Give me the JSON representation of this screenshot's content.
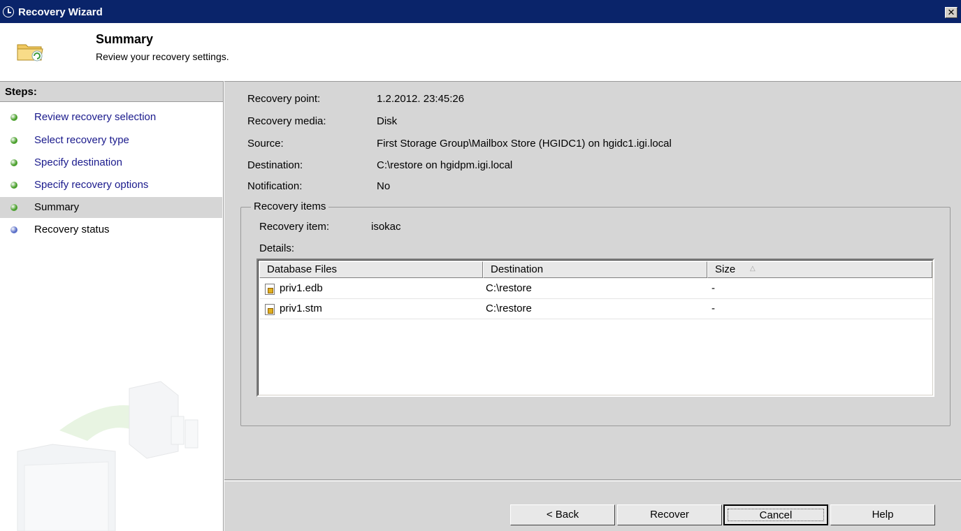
{
  "window": {
    "title": "Recovery Wizard",
    "close_glyph": "✕",
    "icon": "clock-icon"
  },
  "header": {
    "title": "Summary",
    "subtitle": "Review your recovery settings.",
    "icon": "folder-recovery-icon"
  },
  "steps": {
    "heading": "Steps:",
    "items": [
      {
        "label": "Review recovery selection",
        "state": "done"
      },
      {
        "label": "Select recovery type",
        "state": "done"
      },
      {
        "label": "Specify destination",
        "state": "done"
      },
      {
        "label": "Specify recovery options",
        "state": "done"
      },
      {
        "label": "Summary",
        "state": "current"
      },
      {
        "label": "Recovery status",
        "state": "future"
      }
    ],
    "colors": {
      "done": "#4aa02c",
      "current": "#4aa02c",
      "future": "#5a6fc8"
    }
  },
  "summary": {
    "recovery_point": {
      "label": "Recovery point:",
      "value": "1.2.2012. 23:45:26"
    },
    "recovery_media": {
      "label": "Recovery media:",
      "value": "Disk"
    },
    "source": {
      "label": "Source:",
      "value": "First Storage Group\\Mailbox Store (HGIDC1) on hgidc1.igi.local"
    },
    "destination": {
      "label": "Destination:",
      "value": "C:\\restore on hgidpm.igi.local"
    },
    "notification": {
      "label": "Notification:",
      "value": "No"
    }
  },
  "recovery_items": {
    "legend": "Recovery items",
    "item_label": "Recovery item:",
    "item_value": "isokac",
    "details_label": "Details:",
    "columns": [
      "Database Files",
      "Destination",
      "Size"
    ],
    "sort_glyph": "△",
    "rows": [
      {
        "file": "priv1.edb",
        "destination": "C:\\restore",
        "size": "-"
      },
      {
        "file": "priv1.stm",
        "destination": "C:\\restore",
        "size": "-"
      }
    ]
  },
  "buttons": {
    "back": "< Back",
    "recover": "Recover",
    "cancel": "Cancel",
    "help": "Help"
  }
}
